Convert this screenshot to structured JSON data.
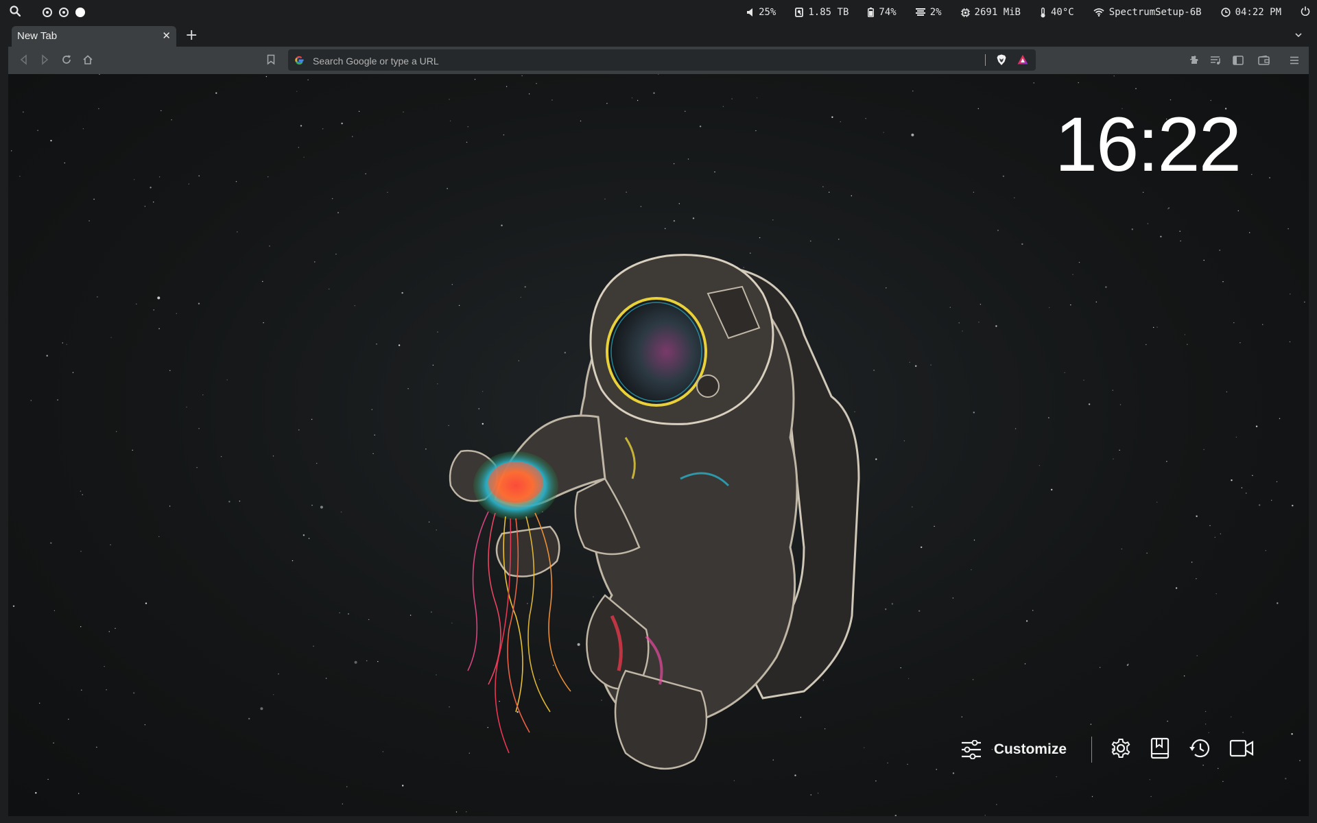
{
  "topbar": {
    "launcher_icon": "search-icon",
    "workspaces": [
      {
        "state": "active"
      },
      {
        "state": "active"
      },
      {
        "state": "filled"
      }
    ],
    "volume": "25%",
    "disk": "1.85 TB",
    "battery": "74%",
    "cpu": "2%",
    "memory": "2691 MiB",
    "temperature": "40°C",
    "wifi": "SpectrumSetup-6B",
    "time": "04:22 PM",
    "power_icon": "power-icon"
  },
  "browser": {
    "tab_title": "New Tab",
    "tab_close": "✕",
    "new_tab": "+",
    "omnibox_placeholder": "Search Google or type a URL"
  },
  "newtab": {
    "clock": "16:22",
    "customize_label": "Customize",
    "bottom_icons": [
      "settings-icon",
      "bookmarks-icon",
      "history-icon",
      "brave-talk-icon"
    ]
  },
  "colors": {
    "topbar_bg": "#1c1e1f",
    "toolbar_bg": "#3b3f42",
    "omnibox_bg": "#26292b",
    "page_bg": "#141617",
    "text": "#f0f0f0"
  }
}
